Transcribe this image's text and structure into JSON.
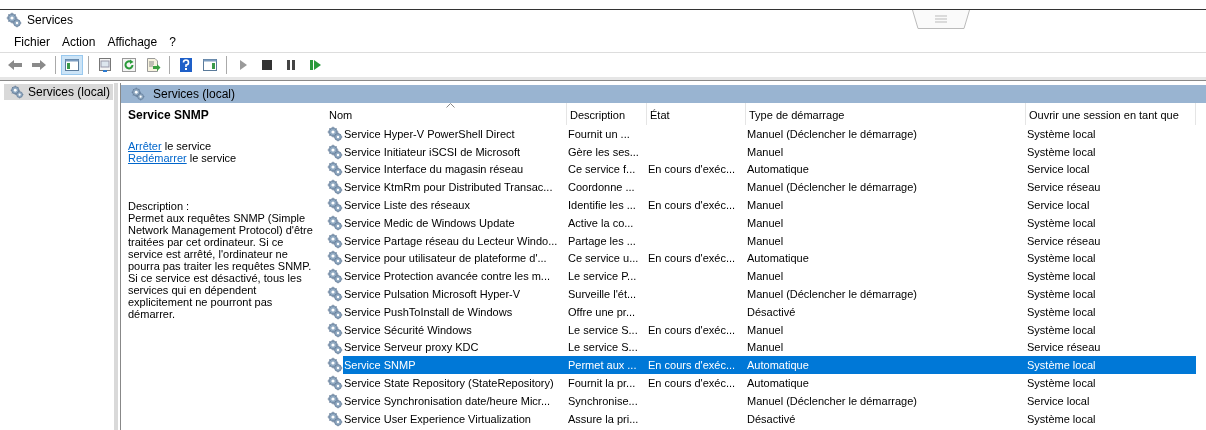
{
  "window": {
    "title": "Services"
  },
  "menu": [
    {
      "label": "Fichier"
    },
    {
      "label": "Action"
    },
    {
      "label": "Affichage"
    },
    {
      "label": "?"
    }
  ],
  "toolbar": [
    {
      "kind": "back",
      "pressed": false
    },
    {
      "kind": "forward",
      "pressed": false
    },
    {
      "kind": "sep"
    },
    {
      "kind": "tree",
      "pressed": true
    },
    {
      "kind": "sep"
    },
    {
      "kind": "properties",
      "pressed": false
    },
    {
      "kind": "refresh",
      "pressed": false
    },
    {
      "kind": "export",
      "pressed": false
    },
    {
      "kind": "sep"
    },
    {
      "kind": "help",
      "pressed": false
    },
    {
      "kind": "pane",
      "pressed": false
    },
    {
      "kind": "sep"
    },
    {
      "kind": "play",
      "pressed": false
    },
    {
      "kind": "stop",
      "pressed": false
    },
    {
      "kind": "pause",
      "pressed": false
    },
    {
      "kind": "resume",
      "pressed": false
    }
  ],
  "tree": [
    {
      "label": "Services (local)",
      "selected": true
    }
  ],
  "header_bar": {
    "title": "Services (local)"
  },
  "details": {
    "title": "Service SNMP",
    "actions": [
      {
        "link": "Arrêter",
        "text": "le service"
      },
      {
        "link": "Redémarrer",
        "text": "le service"
      }
    ],
    "description_label": "Description :",
    "description": "Permet aux requêtes SNMP (Simple Network Management Protocol) d'être traitées par cet ordinateur. Si ce service est arrêté, l'ordinateur ne pourra pas traiter les requêtes SNMP. Si ce service est désactivé, tous les services qui en dépendent explicitement ne pourront pas démarrer."
  },
  "table": {
    "columns": [
      {
        "label": "Nom",
        "sorted": true
      },
      {
        "label": "Description",
        "sorted": false
      },
      {
        "label": "État",
        "sorted": false
      },
      {
        "label": "Type de démarrage",
        "sorted": false
      },
      {
        "label": "Ouvrir une session en tant que",
        "sorted": false
      }
    ],
    "rows": [
      {
        "cells": [
          "Service Hyper-V PowerShell Direct",
          "Fournit un ...",
          "",
          "Manuel (Déclencher le démarrage)",
          "Système local"
        ],
        "selected": false
      },
      {
        "cells": [
          "Service Initiateur iSCSI de Microsoft",
          "Gère les ses...",
          "",
          "Manuel",
          "Système local"
        ],
        "selected": false
      },
      {
        "cells": [
          "Service Interface du magasin réseau",
          "Ce service f...",
          "En cours d'exéc...",
          "Automatique",
          "Service local"
        ],
        "selected": false
      },
      {
        "cells": [
          "Service KtmRm pour Distributed Transac...",
          "Coordonne ...",
          "",
          "Manuel (Déclencher le démarrage)",
          "Service réseau"
        ],
        "selected": false
      },
      {
        "cells": [
          "Service Liste des réseaux",
          "Identifie les ...",
          "En cours d'exéc...",
          "Manuel",
          "Service local"
        ],
        "selected": false
      },
      {
        "cells": [
          "Service Medic de Windows Update",
          "Active la co...",
          "",
          "Manuel",
          "Système local"
        ],
        "selected": false
      },
      {
        "cells": [
          "Service Partage réseau du Lecteur Windo...",
          "Partage les ...",
          "",
          "Manuel",
          "Service réseau"
        ],
        "selected": false
      },
      {
        "cells": [
          "Service pour utilisateur de plateforme d'...",
          "Ce service u...",
          "En cours d'exéc...",
          "Automatique",
          "Système local"
        ],
        "selected": false
      },
      {
        "cells": [
          "Service Protection avancée contre les m...",
          "Le service P...",
          "",
          "Manuel",
          "Système local"
        ],
        "selected": false
      },
      {
        "cells": [
          "Service Pulsation Microsoft Hyper-V",
          "Surveille l'ét...",
          "",
          "Manuel (Déclencher le démarrage)",
          "Système local"
        ],
        "selected": false
      },
      {
        "cells": [
          "Service PushToInstall de Windows",
          "Offre une pr...",
          "",
          "Désactivé",
          "Système local"
        ],
        "selected": false
      },
      {
        "cells": [
          "Service Sécurité Windows",
          "Le service S...",
          "En cours d'exéc...",
          "Manuel",
          "Système local"
        ],
        "selected": false
      },
      {
        "cells": [
          "Service Serveur proxy KDC",
          "Le service S...",
          "",
          "Manuel",
          "Service réseau"
        ],
        "selected": false
      },
      {
        "cells": [
          "Service SNMP",
          "Permet aux ...",
          "En cours d'exéc...",
          "Automatique",
          "Système local"
        ],
        "selected": true
      },
      {
        "cells": [
          "Service State Repository (StateRepository)",
          "Fournit la pr...",
          "En cours d'exéc...",
          "Automatique",
          "Système local"
        ],
        "selected": false
      },
      {
        "cells": [
          "Service Synchronisation date/heure Micr...",
          "Synchronise...",
          "",
          "Manuel (Déclencher le démarrage)",
          "Service local"
        ],
        "selected": false
      },
      {
        "cells": [
          "Service User Experience Virtualization",
          "Assure la pri...",
          "",
          "Désactivé",
          "Système local"
        ],
        "selected": false
      }
    ]
  }
}
